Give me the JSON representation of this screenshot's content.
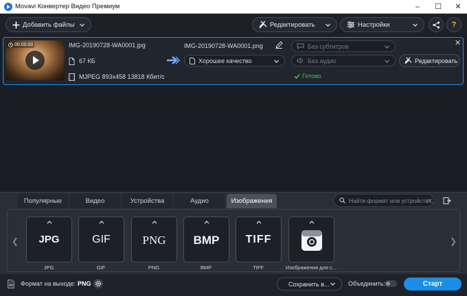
{
  "window": {
    "title": "Movavi Конвертер Видео Премиум",
    "minimize": "–",
    "maximize": "☐",
    "close": "✕"
  },
  "toolbar": {
    "add_files": "Добавить файлы",
    "edit": "Редактировать",
    "settings": "Настройки",
    "help": "?"
  },
  "file": {
    "duration": "00:00:00",
    "source_name": "IMG-20190728-WA0001.jpg",
    "source_size": "67 КБ",
    "source_info": "MJPEG 893x458 13818 Кбит/с",
    "output_name": "IMG-20190728-WA0001.png",
    "quality": "Хорошее качество",
    "subtitles": "Без субтитров",
    "audio": "Без аудио",
    "edit_button": "Редактировать",
    "status": "Готово",
    "remove": "✕"
  },
  "tabs": [
    {
      "label": "Популярные"
    },
    {
      "label": "Видео"
    },
    {
      "label": "Устройства"
    },
    {
      "label": "Аудио"
    },
    {
      "label": "Изображения"
    }
  ],
  "search": {
    "placeholder": "Найти формат или устройств..."
  },
  "formats": [
    {
      "logo": "JPG",
      "label": "JPG"
    },
    {
      "logo": "GIF",
      "label": "GIF"
    },
    {
      "logo": "PNG",
      "label": "PNG"
    },
    {
      "logo": "BMP",
      "label": "BMP"
    },
    {
      "logo": "TIFF",
      "label": "TIFF"
    },
    {
      "logo": "",
      "label": "Изображения для с..."
    }
  ],
  "footer": {
    "output_format_label": "Формат на выходе:",
    "output_format_value": "PNG",
    "save_to": "Сохранить в...",
    "merge_label": "Объединить:",
    "start": "Старт"
  },
  "colors": {
    "accent": "#1a8ee6",
    "status_ok": "#45c25a",
    "selection_border": "#1f8fe8"
  }
}
